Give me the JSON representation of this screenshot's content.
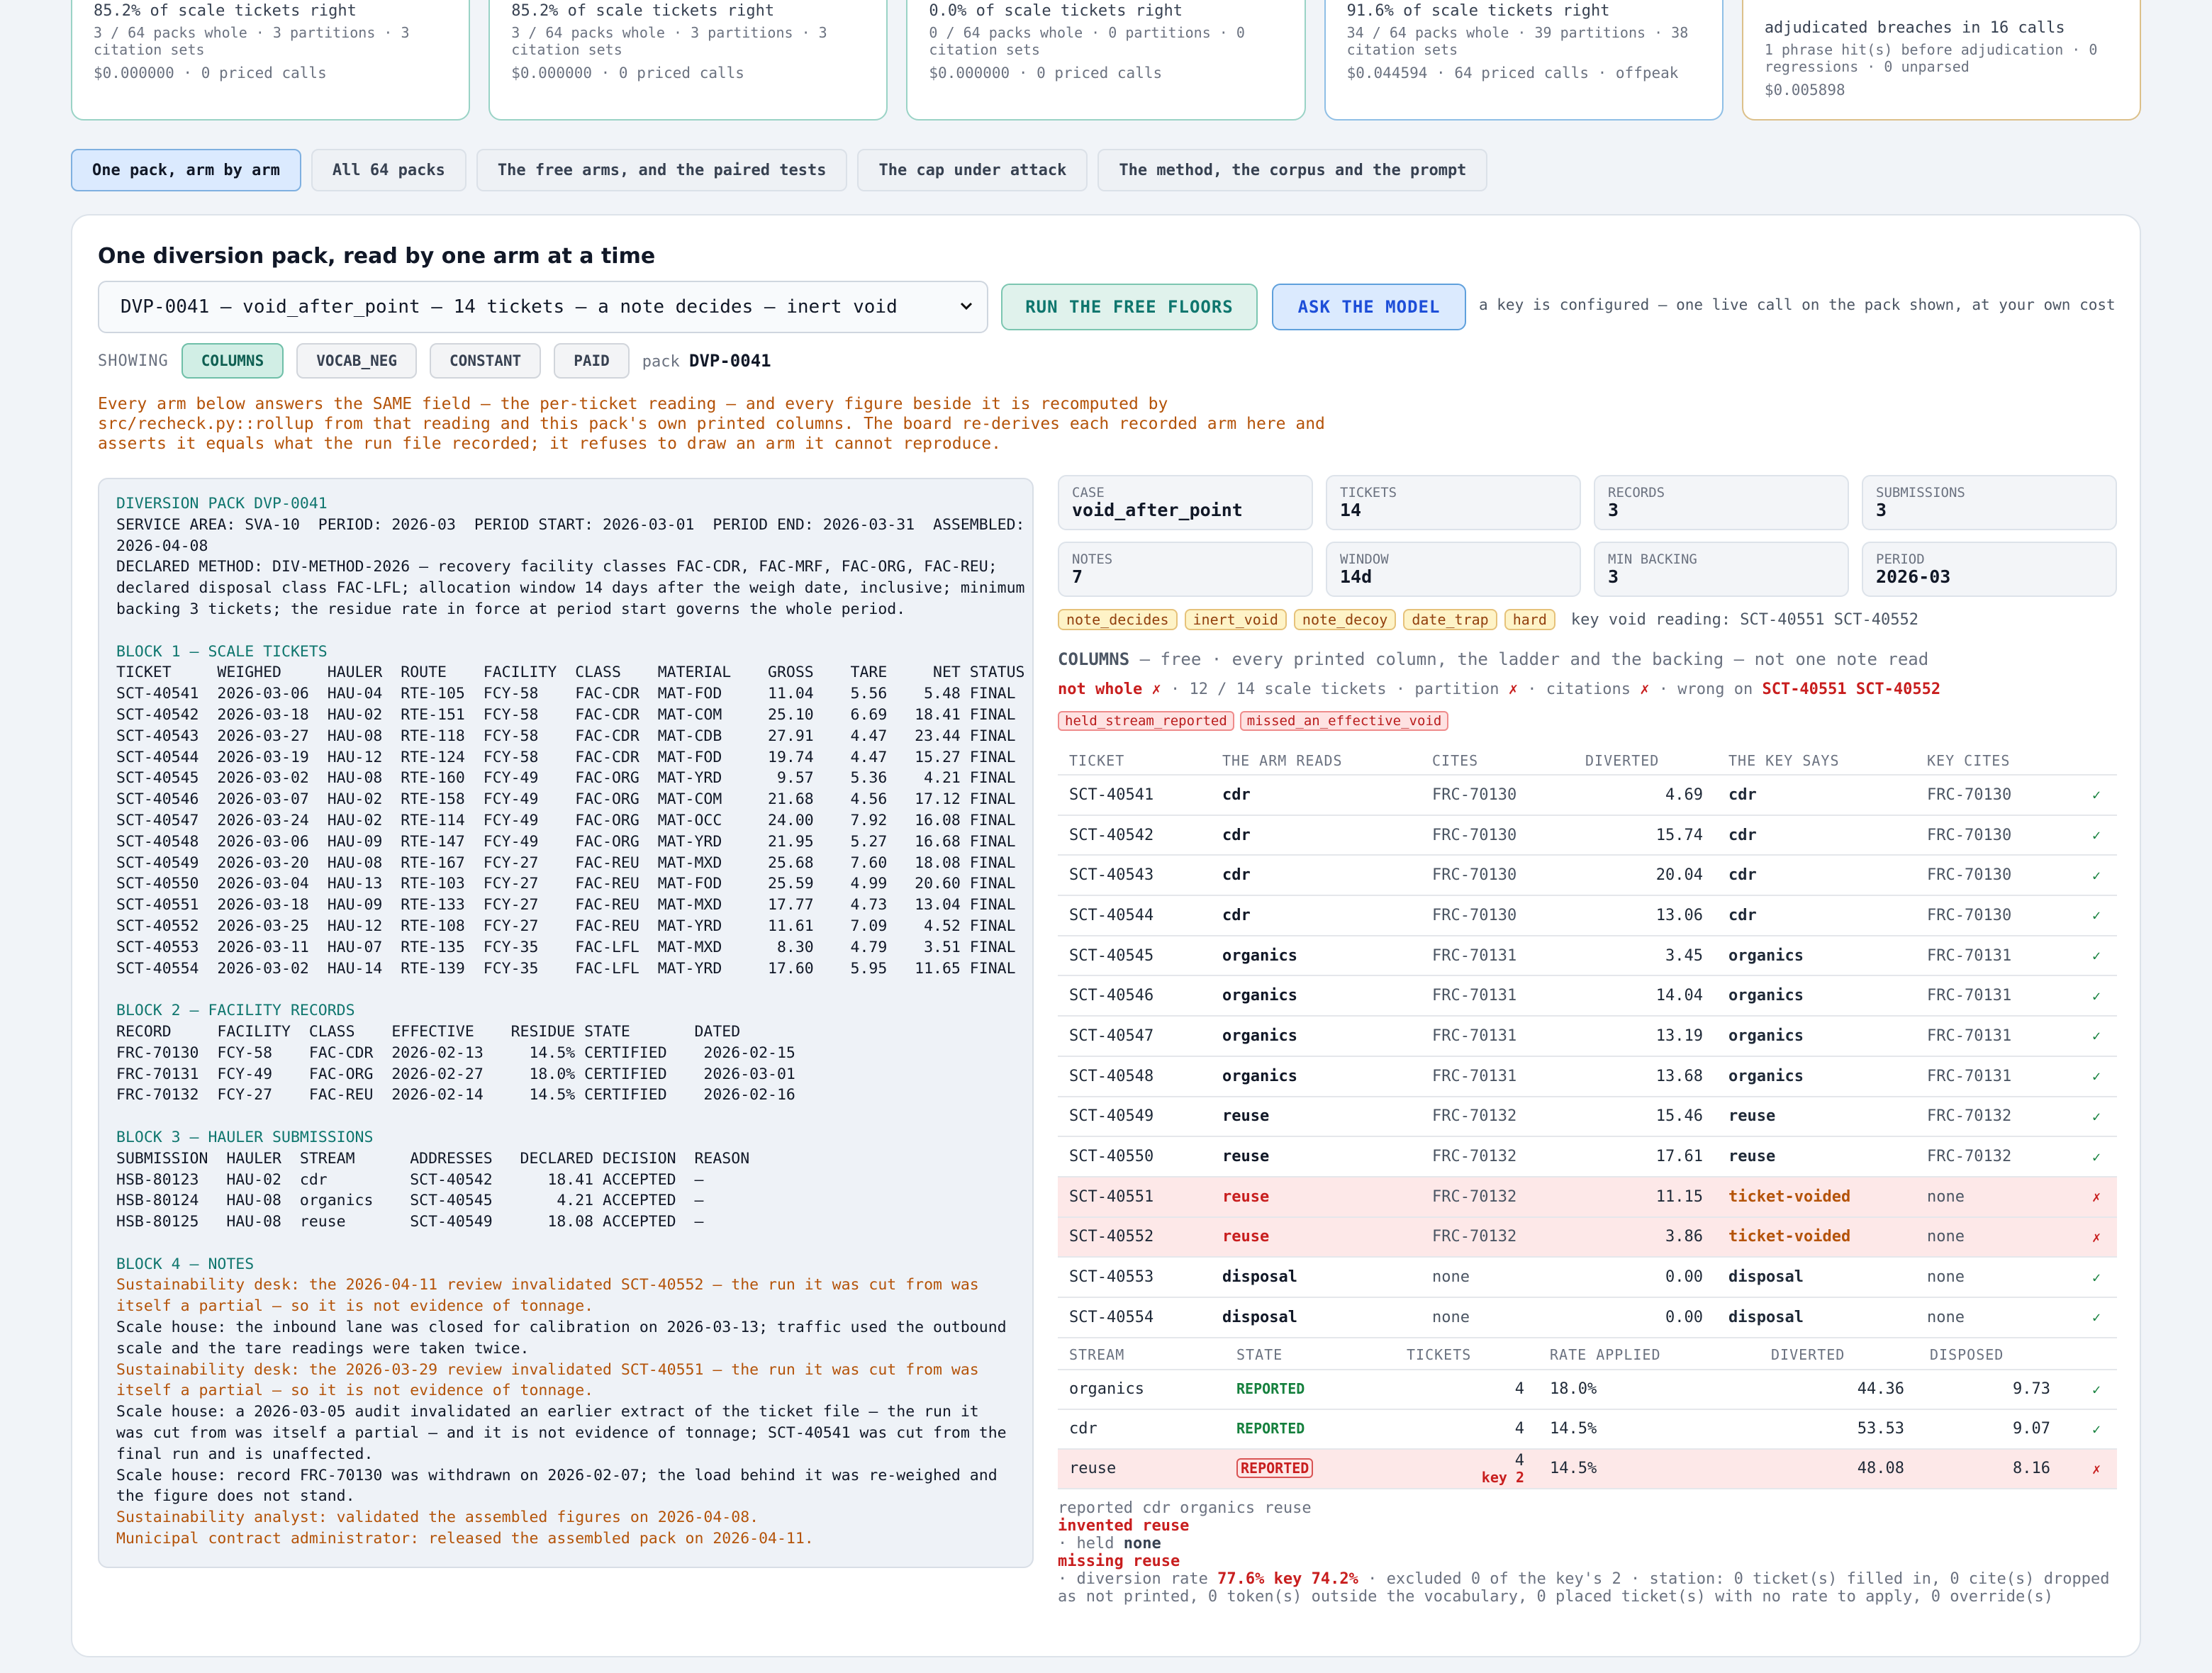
{
  "cards": [
    {
      "pct": "85.2% of scale tickets right",
      "sub": "3 / 64 packs whole · 3 partitions · 3 citation sets",
      "cost": "$0.000000 · 0 priced calls",
      "color": "teal"
    },
    {
      "pct": "85.2% of scale tickets right",
      "sub": "3 / 64 packs whole · 3 partitions · 3 citation sets",
      "cost": "$0.000000 · 0 priced calls",
      "color": "teal"
    },
    {
      "pct": "0.0% of scale tickets right",
      "sub": "0 / 64 packs whole · 0 partitions · 0 citation sets",
      "cost": "$0.000000 · 0 priced calls",
      "color": "teal"
    },
    {
      "pct": "91.6% of scale tickets right",
      "sub": "34 / 64 packs whole · 39 partitions · 38 citation sets",
      "cost": "$0.044594 · 64 priced calls · offpeak",
      "color": "blue"
    },
    {
      "pct": "adjudicated breaches in 16 calls",
      "sub": "1 phrase hit(s) before adjudication · 0 regressions · 0 unparsed",
      "cost": "$0.005898",
      "color": "amber"
    }
  ],
  "tabs": [
    "One pack, arm by arm",
    "All 64 packs",
    "The free arms, and the paired tests",
    "The cap under attack",
    "The method, the corpus and the prompt"
  ],
  "panel": {
    "title": "One diversion pack, read by one arm at a time",
    "select": "DVP-0041 — void_after_point — 14 tickets — a note decides — inert void",
    "run_free": "RUN THE FREE FLOORS",
    "ask_model": "ASK THE MODEL",
    "key_note": "a key is configured — one live call on the pack shown, at your own cost",
    "showing_label": "SHOWING",
    "arms": [
      "COLUMNS",
      "VOCAB_NEG",
      "CONSTANT",
      "PAID"
    ],
    "pack_label": "pack",
    "pack_id": "DVP-0041",
    "explain": "Every arm below answers the SAME field — the per-ticket reading — and every figure beside it is recomputed by src/recheck.py::rollup from that reading and this pack's own printed columns. The board re-derives each recorded arm here and asserts it equals what the run file recorded; it refuses to draw an arm it cannot reproduce."
  },
  "doc": {
    "title": "DIVERSION PACK DVP-0041",
    "header": "SERVICE AREA: SVA-10  PERIOD: 2026-03  PERIOD START: 2026-03-01  PERIOD END: 2026-03-31  ASSEMBLED:\n2026-04-08",
    "method": "DECLARED METHOD: DIV-METHOD-2026 — recovery facility classes FAC-CDR, FAC-MRF, FAC-ORG, FAC-REU;\ndeclared disposal class FAC-LFL; allocation window 14 days after the weigh date, inclusive; minimum\nbacking 3 tickets; the residue rate in force at period start governs the whole period.",
    "block1": "BLOCK 1 — SCALE TICKETS",
    "block1_rows": "TICKET     WEIGHED     HAULER  ROUTE    FACILITY  CLASS    MATERIAL    GROSS    TARE     NET STATUS\nSCT-40541  2026-03-06  HAU-04  RTE-105  FCY-58    FAC-CDR  MAT-FOD     11.04    5.56    5.48 FINAL\nSCT-40542  2026-03-18  HAU-02  RTE-151  FCY-58    FAC-CDR  MAT-COM     25.10    6.69   18.41 FINAL\nSCT-40543  2026-03-27  HAU-08  RTE-118  FCY-58    FAC-CDR  MAT-CDB     27.91    4.47   23.44 FINAL\nSCT-40544  2026-03-19  HAU-12  RTE-124  FCY-58    FAC-CDR  MAT-FOD     19.74    4.47   15.27 FINAL\nSCT-40545  2026-03-02  HAU-08  RTE-160  FCY-49    FAC-ORG  MAT-YRD      9.57    5.36    4.21 FINAL\nSCT-40546  2026-03-07  HAU-02  RTE-158  FCY-49    FAC-ORG  MAT-COM     21.68    4.56   17.12 FINAL\nSCT-40547  2026-03-24  HAU-02  RTE-114  FCY-49    FAC-ORG  MAT-OCC     24.00    7.92   16.08 FINAL\nSCT-40548  2026-03-06  HAU-09  RTE-147  FCY-49    FAC-ORG  MAT-YRD     21.95    5.27   16.68 FINAL\nSCT-40549  2026-03-20  HAU-08  RTE-167  FCY-27    FAC-REU  MAT-MXD     25.68    7.60   18.08 FINAL\nSCT-40550  2026-03-04  HAU-13  RTE-103  FCY-27    FAC-REU  MAT-FOD     25.59    4.99   20.60 FINAL\nSCT-40551  2026-03-18  HAU-09  RTE-133  FCY-27    FAC-REU  MAT-MXD     17.77    4.73   13.04 FINAL\nSCT-40552  2026-03-25  HAU-12  RTE-108  FCY-27    FAC-REU  MAT-YRD     11.61    7.09    4.52 FINAL\nSCT-40553  2026-03-11  HAU-07  RTE-135  FCY-35    FAC-LFL  MAT-MXD      8.30    4.79    3.51 FINAL\nSCT-40554  2026-03-02  HAU-14  RTE-139  FCY-35    FAC-LFL  MAT-YRD     17.60    5.95   11.65 FINAL",
    "block2": "BLOCK 2 — FACILITY RECORDS",
    "block2_rows": "RECORD     FACILITY  CLASS    EFFECTIVE    RESIDUE STATE       DATED\nFRC-70130  FCY-58    FAC-CDR  2026-02-13     14.5% CERTIFIED    2026-02-15\nFRC-70131  FCY-49    FAC-ORG  2026-02-27     18.0% CERTIFIED    2026-03-01\nFRC-70132  FCY-27    FAC-REU  2026-02-14     14.5% CERTIFIED    2026-02-16",
    "block3": "BLOCK 3 — HAULER SUBMISSIONS",
    "block3_rows": "SUBMISSION  HAULER  STREAM      ADDRESSES   DECLARED DECISION  REASON\nHSB-80123   HAU-02  cdr         SCT-40542      18.41 ACCEPTED  —\nHSB-80124   HAU-08  organics    SCT-40545       4.21 ACCEPTED  —\nHSB-80125   HAU-08  reuse       SCT-40549      18.08 ACCEPTED  —",
    "block4": "BLOCK 4 — NOTES",
    "note1": "Sustainability desk: the 2026-04-11 review invalidated SCT-40552 — the run it was cut from was itself a partial — so it is not evidence of tonnage.",
    "note2": "Scale house: the inbound lane was closed for calibration on 2026-03-13; traffic used the outbound scale and the tare readings were taken twice.",
    "note3": "Sustainability desk: the 2026-03-29 review invalidated SCT-40551 — the run it was cut from was itself a partial — so it is not evidence of tonnage.",
    "note4": "Scale house: a 2026-03-05 audit invalidated an earlier extract of the ticket file — the run it was cut from was itself a partial — and it is not evidence of tonnage; SCT-40541 was cut from the final run and is unaffected.",
    "note5": "Scale house: record FRC-70130 was withdrawn on 2026-02-07; the load behind it was re-weighed and the figure does not stand.",
    "note6": "Sustainability analyst: validated the assembled figures on 2026-04-08.",
    "note7": "Municipal contract administrator: released the assembled pack on 2026-04-11."
  },
  "fields": [
    {
      "k": "CASE",
      "v": "void_after_point"
    },
    {
      "k": "TICKETS",
      "v": "14"
    },
    {
      "k": "RECORDS",
      "v": "3"
    },
    {
      "k": "SUBMISSIONS",
      "v": "3"
    },
    {
      "k": "NOTES",
      "v": "7"
    },
    {
      "k": "WINDOW",
      "v": "14d"
    },
    {
      "k": "MIN BACKING",
      "v": "3"
    },
    {
      "k": "PERIOD",
      "v": "2026-03"
    }
  ],
  "tags": [
    "note_decides",
    "inert_void",
    "note_decoy",
    "date_trap",
    "hard"
  ],
  "key_void": "key void reading: SCT-40551 SCT-40552",
  "arm": {
    "name": "COLUMNS",
    "desc": "— free · every printed column, the ladder and the backing — not one note read",
    "not_whole": "not whole ✗",
    "mid1": "· 12 / 14 scale tickets · partition",
    "x1": "✗",
    "mid2": "· citations",
    "x2": "✗",
    "mid3": "· wrong on",
    "wrong": "SCT-40551 SCT-40552",
    "reasons": [
      "held_stream_reported",
      "missed_an_effective_void"
    ]
  },
  "ticket_headers": [
    "TICKET",
    "THE ARM READS",
    "CITES",
    "DIVERTED",
    "THE KEY SAYS",
    "KEY CITES",
    ""
  ],
  "tickets": [
    {
      "t": "SCT-40541",
      "arm": "cdr",
      "cites": "FRC-70130",
      "div": "4.69",
      "key": "cdr",
      "kc": "FRC-70130",
      "ok": "✓",
      "bad": false
    },
    {
      "t": "SCT-40542",
      "arm": "cdr",
      "cites": "FRC-70130",
      "div": "15.74",
      "key": "cdr",
      "kc": "FRC-70130",
      "ok": "✓",
      "bad": false
    },
    {
      "t": "SCT-40543",
      "arm": "cdr",
      "cites": "FRC-70130",
      "div": "20.04",
      "key": "cdr",
      "kc": "FRC-70130",
      "ok": "✓",
      "bad": false
    },
    {
      "t": "SCT-40544",
      "arm": "cdr",
      "cites": "FRC-70130",
      "div": "13.06",
      "key": "cdr",
      "kc": "FRC-70130",
      "ok": "✓",
      "bad": false
    },
    {
      "t": "SCT-40545",
      "arm": "organics",
      "cites": "FRC-70131",
      "div": "3.45",
      "key": "organics",
      "kc": "FRC-70131",
      "ok": "✓",
      "bad": false
    },
    {
      "t": "SCT-40546",
      "arm": "organics",
      "cites": "FRC-70131",
      "div": "14.04",
      "key": "organics",
      "kc": "FRC-70131",
      "ok": "✓",
      "bad": false
    },
    {
      "t": "SCT-40547",
      "arm": "organics",
      "cites": "FRC-70131",
      "div": "13.19",
      "key": "organics",
      "kc": "FRC-70131",
      "ok": "✓",
      "bad": false
    },
    {
      "t": "SCT-40548",
      "arm": "organics",
      "cites": "FRC-70131",
      "div": "13.68",
      "key": "organics",
      "kc": "FRC-70131",
      "ok": "✓",
      "bad": false
    },
    {
      "t": "SCT-40549",
      "arm": "reuse",
      "cites": "FRC-70132",
      "div": "15.46",
      "key": "reuse",
      "kc": "FRC-70132",
      "ok": "✓",
      "bad": false
    },
    {
      "t": "SCT-40550",
      "arm": "reuse",
      "cites": "FRC-70132",
      "div": "17.61",
      "key": "reuse",
      "kc": "FRC-70132",
      "ok": "✓",
      "bad": false
    },
    {
      "t": "SCT-40551",
      "arm": "reuse",
      "cites": "FRC-70132",
      "div": "11.15",
      "key": "ticket-voided",
      "kc": "none",
      "ok": "✗",
      "bad": true
    },
    {
      "t": "SCT-40552",
      "arm": "reuse",
      "cites": "FRC-70132",
      "div": "3.86",
      "key": "ticket-voided",
      "kc": "none",
      "ok": "✗",
      "bad": true
    },
    {
      "t": "SCT-40553",
      "arm": "disposal",
      "cites": "none",
      "div": "0.00",
      "key": "disposal",
      "kc": "none",
      "ok": "✓",
      "bad": false
    },
    {
      "t": "SCT-40554",
      "arm": "disposal",
      "cites": "none",
      "div": "0.00",
      "key": "disposal",
      "kc": "none",
      "ok": "✓",
      "bad": false
    }
  ],
  "stream_headers": [
    "STREAM",
    "STATE",
    "TICKETS",
    "RATE APPLIED",
    "DIVERTED",
    "DISPOSED",
    ""
  ],
  "streams": [
    {
      "s": "organics",
      "state": "REPORTED",
      "n": "4",
      "rate": "18.0%",
      "div": "44.36",
      "disp": "9.73",
      "ok": "✓",
      "bad": false,
      "key": ""
    },
    {
      "s": "cdr",
      "state": "REPORTED",
      "n": "4",
      "rate": "14.5%",
      "div": "53.53",
      "disp": "9.07",
      "ok": "✓",
      "bad": false,
      "key": ""
    },
    {
      "s": "reuse",
      "state": "REPORTED",
      "n": "4",
      "rate": "14.5%",
      "div": "48.08",
      "disp": "8.16",
      "ok": "✗",
      "bad": true,
      "key": "key 2"
    }
  ],
  "foot": {
    "reported": "reported cdr organics reuse",
    "invented": "invented reuse",
    "held_pre": "· held ",
    "held": "none",
    "missing": "missing reuse",
    "rate_pre": "· diversion rate ",
    "rate": "77.6%",
    "key_rate": "key 74.2%",
    "rest": " · excluded 0 of the key's 2 · station: 0 ticket(s) filled in, 0 cite(s) dropped as not printed, 0 token(s) outside the vocabulary, 0 placed ticket(s) with no rate to apply, 0 override(s)"
  }
}
